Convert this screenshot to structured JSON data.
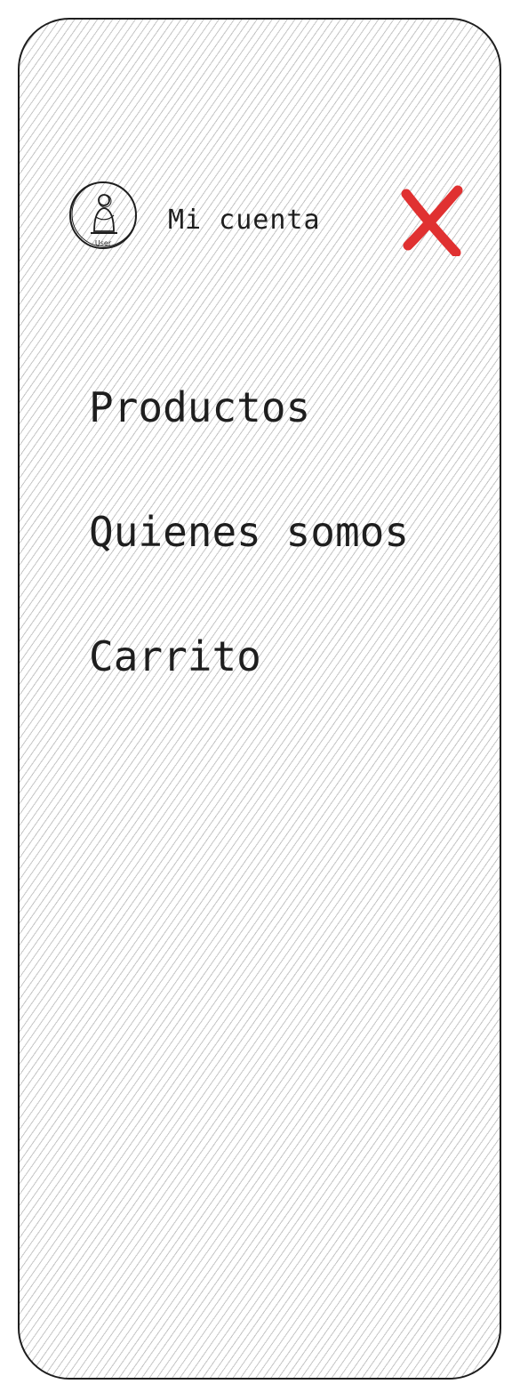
{
  "header": {
    "avatar_caption": "User",
    "account_label": "Mi cuenta",
    "close_icon": "close-x-icon",
    "close_color": "#e03131"
  },
  "menu": {
    "items": [
      {
        "label": "Productos"
      },
      {
        "label": "Quienes somos"
      },
      {
        "label": "Carrito"
      }
    ]
  },
  "colors": {
    "ink": "#1e1e1e",
    "hatch": "#969696"
  }
}
